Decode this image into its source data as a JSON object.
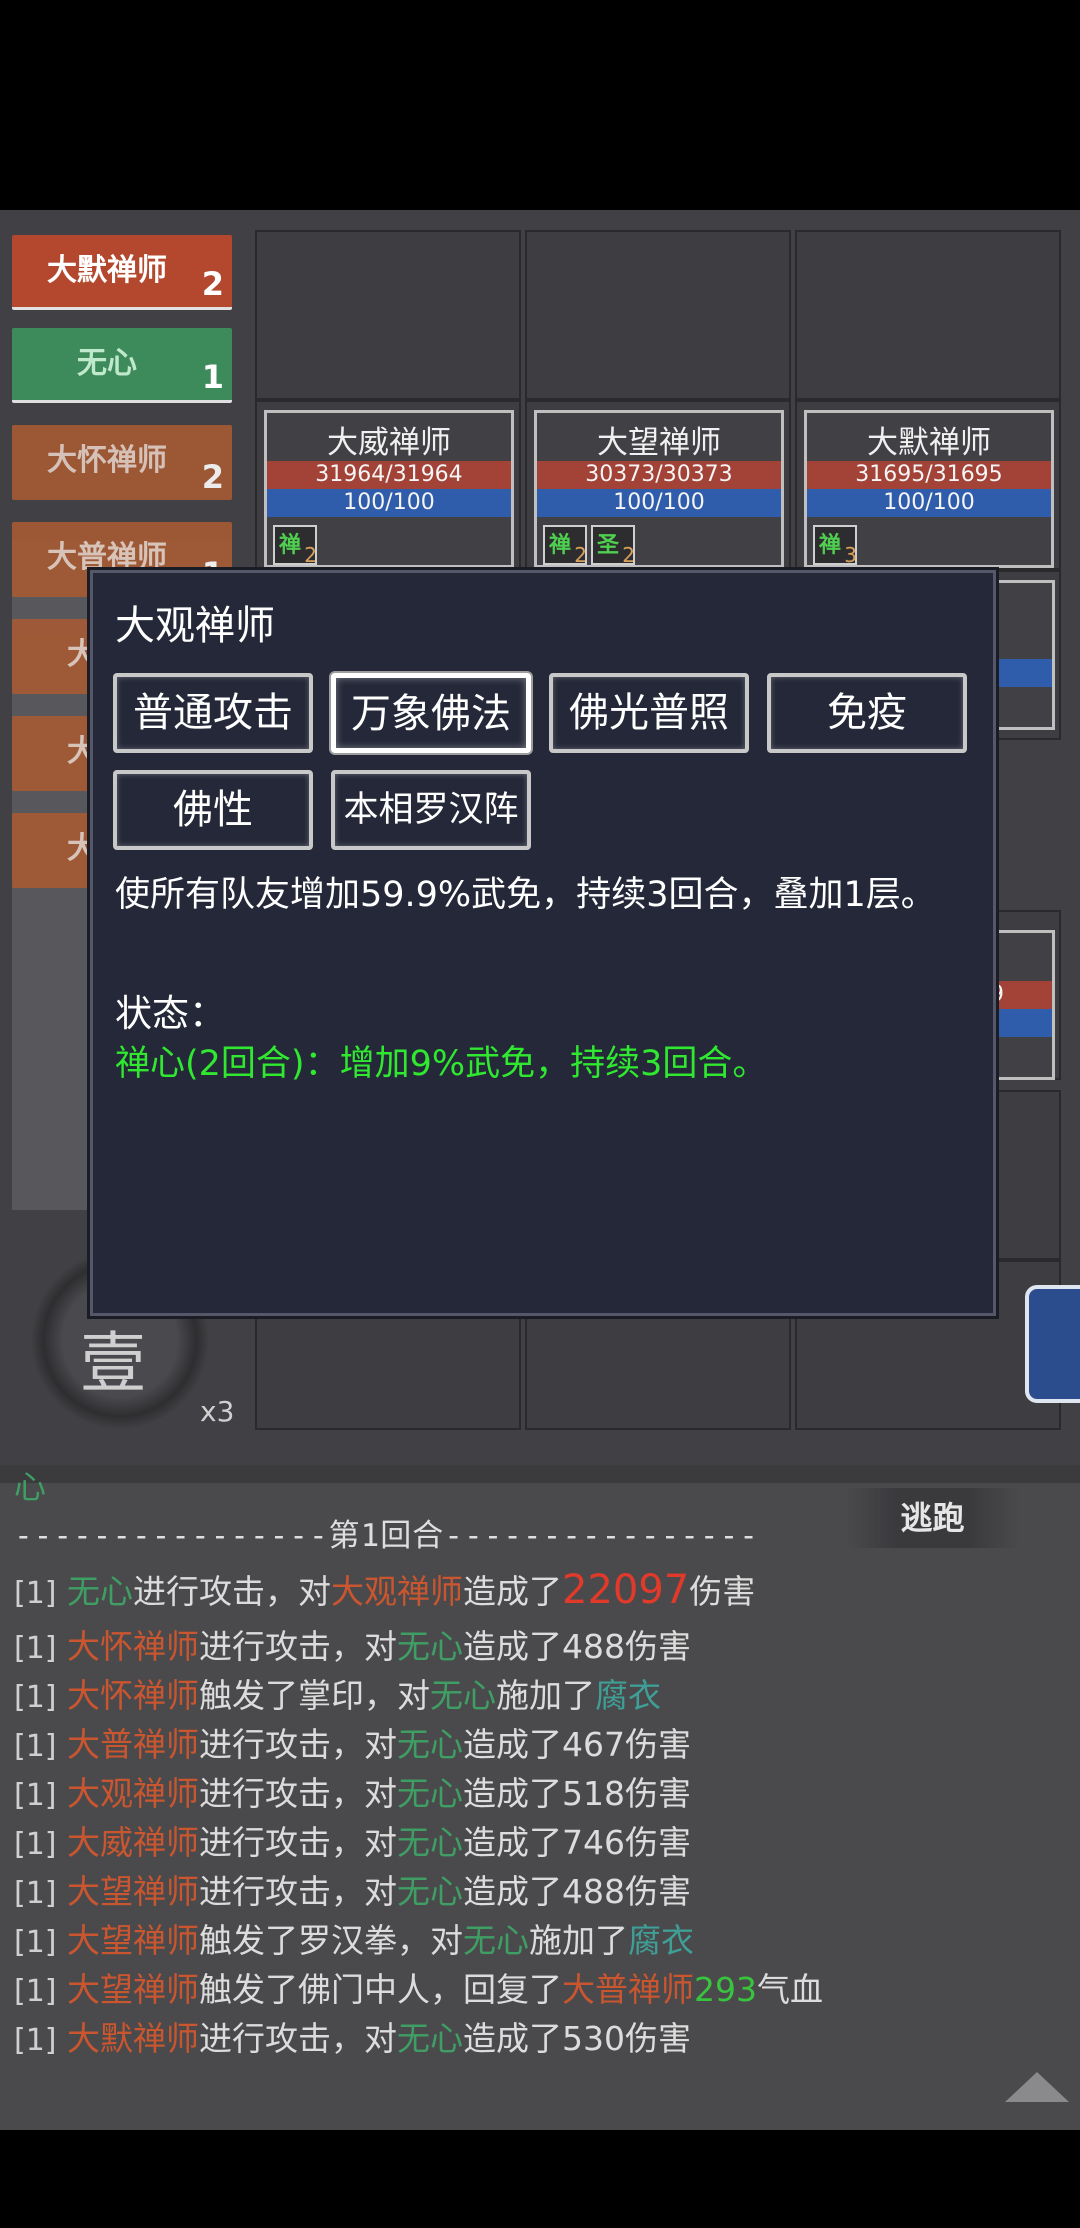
{
  "roster": [
    {
      "name": "大默禅师",
      "count": "2"
    },
    {
      "name": "无心",
      "count": "1"
    },
    {
      "name": "大怀禅师",
      "count": "2"
    },
    {
      "name": "大普禅师",
      "count": "1"
    },
    {
      "name": "大",
      "count": ""
    },
    {
      "name": "大",
      "count": ""
    },
    {
      "name": "大",
      "count": ""
    }
  ],
  "cards": [
    {
      "name": "大威禅师",
      "hp": "31964/31964",
      "mp": "100/100",
      "buffs": [
        {
          "label": "禅",
          "count": "2"
        }
      ]
    },
    {
      "name": "大望禅师",
      "hp": "30373/30373",
      "mp": "100/100",
      "buffs": [
        {
          "label": "禅",
          "count": "2"
        },
        {
          "label": "圣",
          "count": "2"
        }
      ]
    },
    {
      "name": "大默禅师",
      "hp": "31695/31695",
      "mp": "100/100",
      "buffs": [
        {
          "label": "禅",
          "count": "3"
        }
      ]
    }
  ],
  "partial_card": {
    "hp_tail": "9"
  },
  "avatar": {
    "char": "壹",
    "count": "x3"
  },
  "popup": {
    "title": "大观禅师",
    "skills": [
      "普通攻击",
      "万象佛法",
      "佛光普照",
      "免疫",
      "佛性",
      "本相罗汉阵"
    ],
    "selected_skill": "万象佛法",
    "description": "使所有队友增加59.9%武免，持续3回合，叠加1层。",
    "status_label": "状态：",
    "status_text": "禅心(2回合)：增加9%武免，持续3回合。"
  },
  "log": {
    "partial_top": "心",
    "round_line": "----------------第1回合----------------",
    "flee_label": "逃跑",
    "entries": [
      {
        "idx": "[1]",
        "a": "无心",
        "v1": "进行攻击，对",
        "b": "大观禅师",
        "v2": "造成了",
        "num": "22097",
        "v3": "伤害"
      },
      {
        "idx": "[1]",
        "a": "大怀禅师",
        "v1": "进行攻击，对",
        "b": "无心",
        "v2": "造成了488伤害"
      },
      {
        "idx": "[1]",
        "a": "大怀禅师",
        "v1": "触发了掌印，对",
        "b": "无心",
        "v2": "施加了",
        "c": "腐衣"
      },
      {
        "idx": "[1]",
        "a": "大普禅师",
        "v1": "进行攻击，对",
        "b": "无心",
        "v2": "造成了467伤害"
      },
      {
        "idx": "[1]",
        "a": "大观禅师",
        "v1": "进行攻击，对",
        "b": "无心",
        "v2": "造成了518伤害"
      },
      {
        "idx": "[1]",
        "a": "大威禅师",
        "v1": "进行攻击，对",
        "b": "无心",
        "v2": "造成了746伤害"
      },
      {
        "idx": "[1]",
        "a": "大望禅师",
        "v1": "进行攻击，对",
        "b": "无心",
        "v2": "造成了488伤害"
      },
      {
        "idx": "[1]",
        "a": "大望禅师",
        "v1": "触发了罗汉拳，对",
        "b": "无心",
        "v2": "施加了",
        "c": "腐衣"
      },
      {
        "idx": "[1]",
        "a": "大望禅师",
        "v1": "触发了佛门中人，回复了",
        "b": "大普禅师",
        "num": "293",
        "v3": "气血"
      },
      {
        "idx": "[1]",
        "a": "大默禅师",
        "v1": "进行攻击，对",
        "b": "无心",
        "v2": "造成了530伤害"
      }
    ]
  },
  "colors": {
    "enemy": "#c9562f",
    "ally": "#3f9e63",
    "debuff": "#3f9e95",
    "crit": "#e23a2a",
    "heal": "#39c43d",
    "status": "#2fe82f"
  }
}
